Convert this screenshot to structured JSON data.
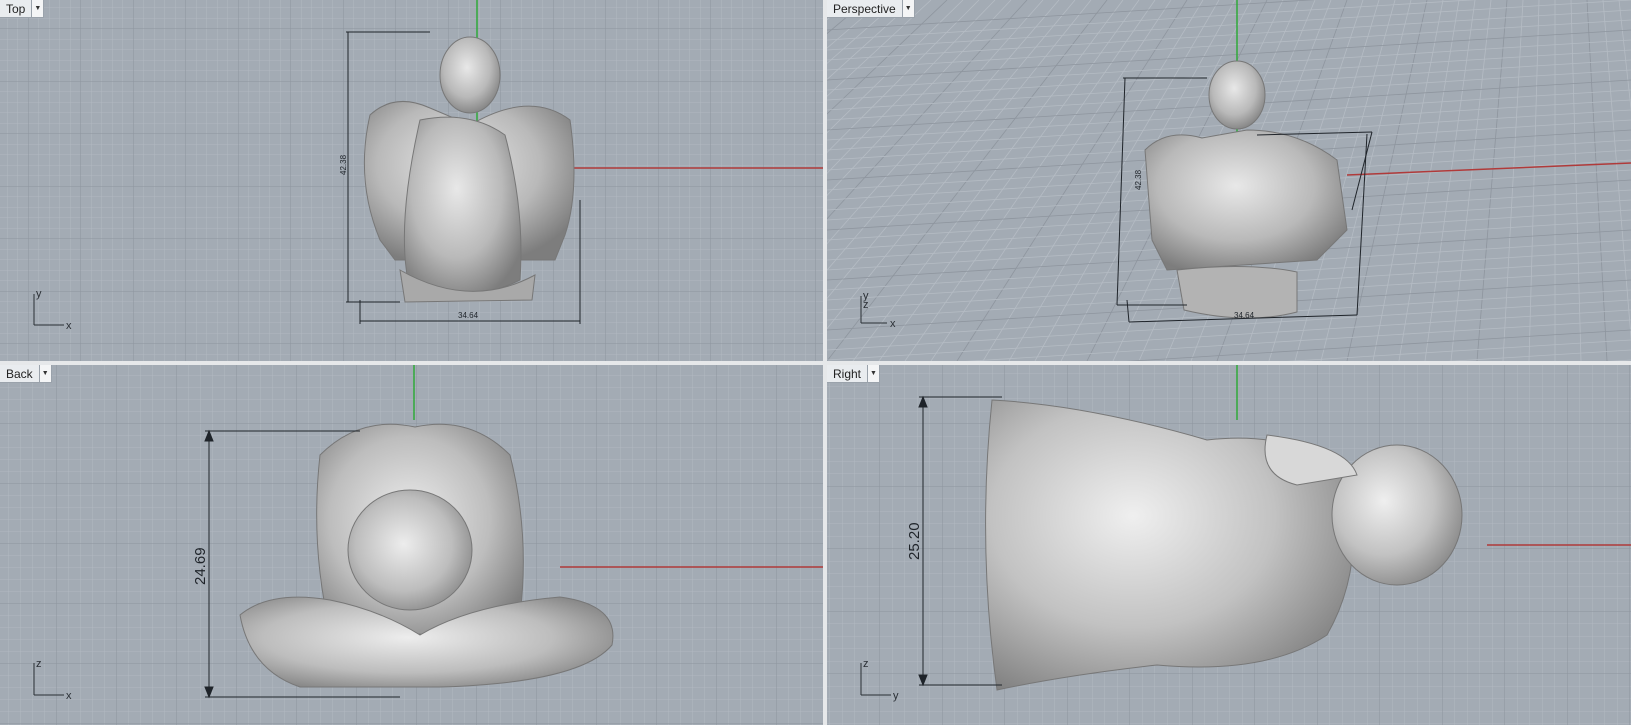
{
  "viewports": {
    "top": {
      "label": "Top",
      "dims": {
        "height": "42.38",
        "width": "34.64"
      },
      "axes": {
        "v": "y",
        "h": "x"
      }
    },
    "perspective": {
      "label": "Perspective",
      "dims": {
        "height": "42.38",
        "width": "34.64"
      },
      "axes": {
        "v": "z",
        "h": "x",
        "vy": "y"
      }
    },
    "back": {
      "label": "Back",
      "dims": {
        "height": "24.69"
      },
      "axes": {
        "v": "z",
        "h": "x"
      }
    },
    "right": {
      "label": "Right",
      "dims": {
        "height": "25.20"
      },
      "axes": {
        "v": "z",
        "h": "y"
      }
    }
  },
  "colors": {
    "grid_bg": "#a3abb4",
    "x_axis": "#b03a3a",
    "y_axis": "#2faa3a",
    "statue": "#c9c9c9"
  },
  "icons": {
    "dropdown": "chevron-down-icon"
  }
}
